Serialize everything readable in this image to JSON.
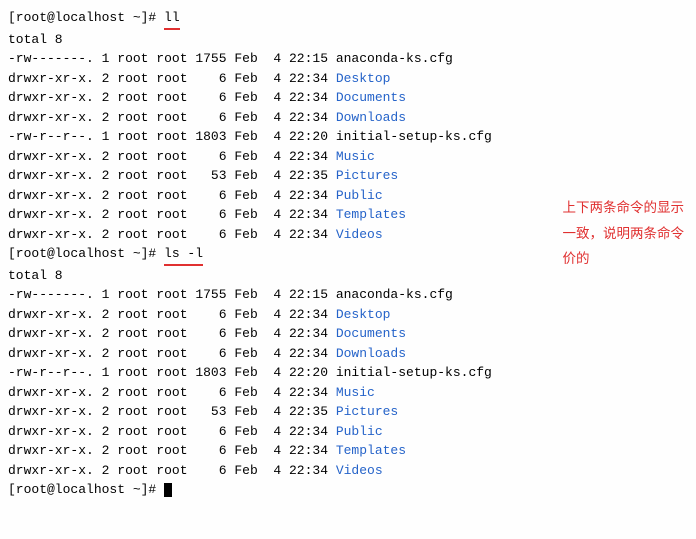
{
  "prompt": "[root@localhost ~]# ",
  "cmd1": "ll",
  "cmd2": "ls -l",
  "total_label": "total 8",
  "annotation": {
    "line1": "上下两条命令的显示",
    "line2": "一致，说明两条命令",
    "line3": "价的"
  },
  "files": [
    {
      "perm": "-rw-------.",
      "links": "1",
      "owner": "root",
      "group": "root",
      "size": "1755",
      "month": "Feb",
      "day": " 4",
      "time": "22:15",
      "name": "anaconda-ks.cfg",
      "dir": false
    },
    {
      "perm": "drwxr-xr-x.",
      "links": "2",
      "owner": "root",
      "group": "root",
      "size": "   6",
      "month": "Feb",
      "day": " 4",
      "time": "22:34",
      "name": "Desktop",
      "dir": true
    },
    {
      "perm": "drwxr-xr-x.",
      "links": "2",
      "owner": "root",
      "group": "root",
      "size": "   6",
      "month": "Feb",
      "day": " 4",
      "time": "22:34",
      "name": "Documents",
      "dir": true
    },
    {
      "perm": "drwxr-xr-x.",
      "links": "2",
      "owner": "root",
      "group": "root",
      "size": "   6",
      "month": "Feb",
      "day": " 4",
      "time": "22:34",
      "name": "Downloads",
      "dir": true
    },
    {
      "perm": "-rw-r--r--.",
      "links": "1",
      "owner": "root",
      "group": "root",
      "size": "1803",
      "month": "Feb",
      "day": " 4",
      "time": "22:20",
      "name": "initial-setup-ks.cfg",
      "dir": false
    },
    {
      "perm": "drwxr-xr-x.",
      "links": "2",
      "owner": "root",
      "group": "root",
      "size": "   6",
      "month": "Feb",
      "day": " 4",
      "time": "22:34",
      "name": "Music",
      "dir": true
    },
    {
      "perm": "drwxr-xr-x.",
      "links": "2",
      "owner": "root",
      "group": "root",
      "size": "  53",
      "month": "Feb",
      "day": " 4",
      "time": "22:35",
      "name": "Pictures",
      "dir": true
    },
    {
      "perm": "drwxr-xr-x.",
      "links": "2",
      "owner": "root",
      "group": "root",
      "size": "   6",
      "month": "Feb",
      "day": " 4",
      "time": "22:34",
      "name": "Public",
      "dir": true
    },
    {
      "perm": "drwxr-xr-x.",
      "links": "2",
      "owner": "root",
      "group": "root",
      "size": "   6",
      "month": "Feb",
      "day": " 4",
      "time": "22:34",
      "name": "Templates",
      "dir": true
    },
    {
      "perm": "drwxr-xr-x.",
      "links": "2",
      "owner": "root",
      "group": "root",
      "size": "   6",
      "month": "Feb",
      "day": " 4",
      "time": "22:34",
      "name": "Videos",
      "dir": true
    }
  ]
}
